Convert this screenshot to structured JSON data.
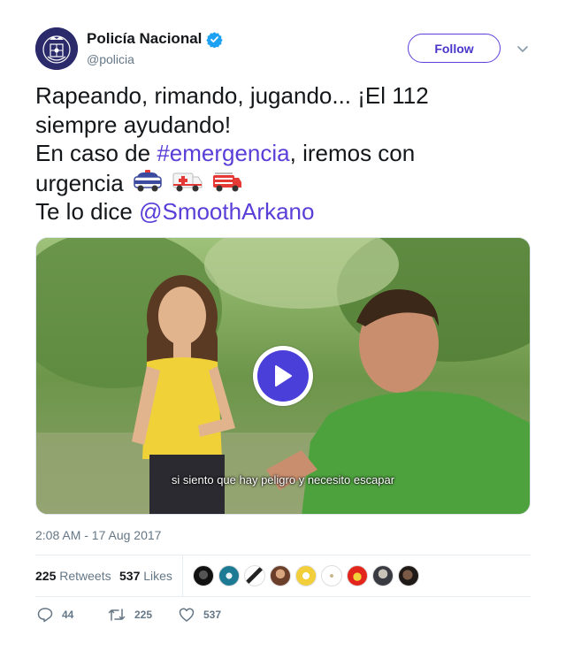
{
  "author": {
    "display_name": "Policía Nacional",
    "handle": "@policia",
    "verified": true,
    "avatar_icon": "police-badge-icon"
  },
  "follow_button": {
    "label": "Follow"
  },
  "tweet": {
    "line1": "Rapeando, rimando, jugando... ¡El 112",
    "line2": "siempre ayudando!",
    "line3_prefix": "En caso de ",
    "hashtag": "#emergencia",
    "line3_suffix": ", iremos con",
    "line4": "urgencia",
    "emojis": [
      "police-car-emoji",
      "ambulance-emoji",
      "fire-engine-emoji"
    ],
    "line5_prefix": "Te lo dice ",
    "mention": "@SmoothArkano"
  },
  "video": {
    "subtitle": "si siento que hay peligro y necesito escapar",
    "play_icon": "play-icon"
  },
  "timestamp": "2:08 AM - 17 Aug 2017",
  "stats": {
    "retweets_count": "225",
    "retweets_label": "Retweets",
    "likes_count": "537",
    "likes_label": "Likes"
  },
  "actions": {
    "replies": "44",
    "retweets": "225",
    "likes": "537"
  },
  "colors": {
    "accent": "#5a3ed8",
    "verified": "#1da1f2",
    "muted": "#657786"
  }
}
